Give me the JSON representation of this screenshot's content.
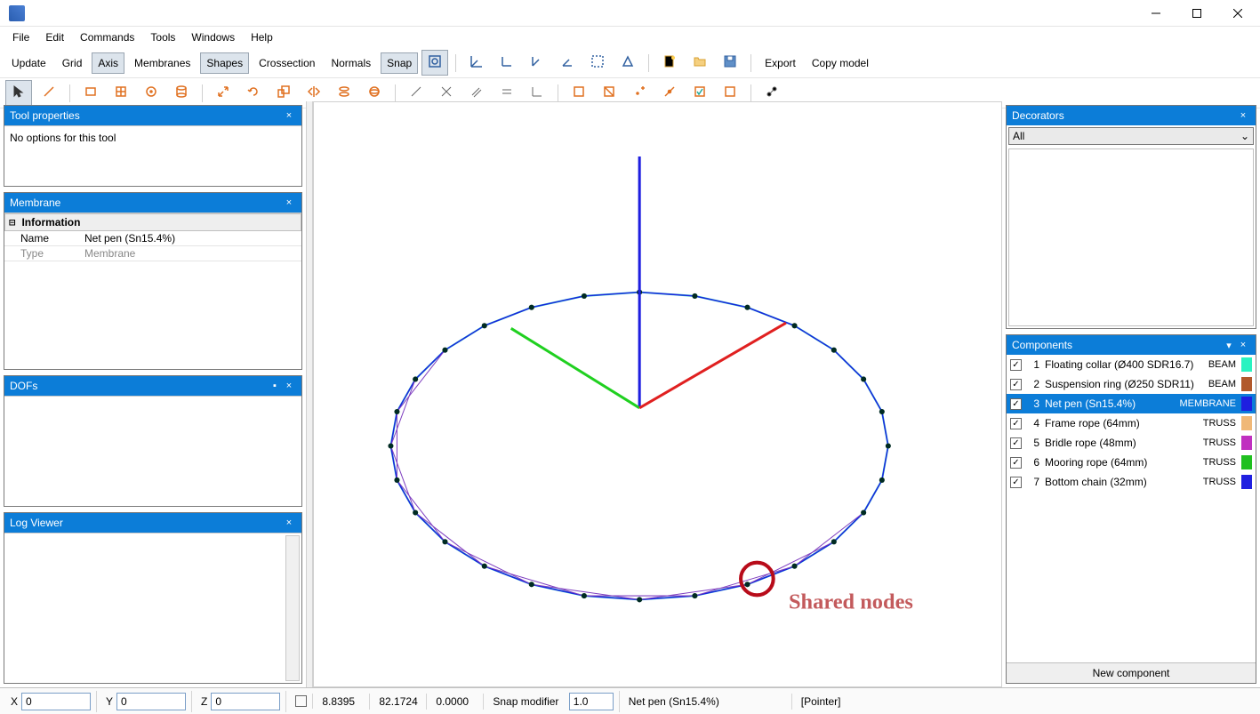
{
  "menu": {
    "file": "File",
    "edit": "Edit",
    "commands": "Commands",
    "tools": "Tools",
    "windows": "Windows",
    "help": "Help"
  },
  "toolbar1": {
    "update": "Update",
    "grid": "Grid",
    "axis": "Axis",
    "membranes": "Membranes",
    "shapes": "Shapes",
    "crossection": "Crossection",
    "normals": "Normals",
    "snap": "Snap",
    "export": "Export",
    "copymodel": "Copy model"
  },
  "panels": {
    "toolprops": {
      "title": "Tool properties",
      "body": "No options for this tool"
    },
    "membrane": {
      "title": "Membrane",
      "section": "Information",
      "name_k": "Name",
      "name_v": "Net pen (Sn15.4%)",
      "type_k": "Type",
      "type_v": "Membrane"
    },
    "dofs": {
      "title": "DOFs"
    },
    "log": {
      "title": "Log Viewer"
    },
    "decorators": {
      "title": "Decorators",
      "all": "All"
    },
    "components": {
      "title": "Components",
      "newcomp": "New component"
    }
  },
  "components": [
    {
      "idx": "1",
      "name": "Floating collar (Ø400 SDR16.7)",
      "type": "BEAM",
      "color": "#29f3c1"
    },
    {
      "idx": "2",
      "name": "Suspension ring (Ø250 SDR11)",
      "type": "BEAM",
      "color": "#b1592c"
    },
    {
      "idx": "3",
      "name": "Net pen (Sn15.4%)",
      "type": "MEMBRANE",
      "color": "#1e1ee0",
      "selected": true
    },
    {
      "idx": "4",
      "name": "Frame rope (64mm)",
      "type": "TRUSS",
      "color": "#f0b878"
    },
    {
      "idx": "5",
      "name": "Bridle rope (48mm)",
      "type": "TRUSS",
      "color": "#c030c0"
    },
    {
      "idx": "6",
      "name": "Mooring rope (64mm)",
      "type": "TRUSS",
      "color": "#20c020"
    },
    {
      "idx": "7",
      "name": "Bottom chain (32mm)",
      "type": "TRUSS",
      "color": "#2020e0"
    }
  ],
  "status": {
    "xlabel": "X",
    "x": "0",
    "ylabel": "Y",
    "y": "0",
    "zlabel": "Z",
    "z": "0",
    "c1": "8.8395",
    "c2": "82.1724",
    "c3": "0.0000",
    "snapmod": "Snap modifier",
    "snapv": "1.0",
    "sel": "Net pen (Sn15.4%)",
    "ptr": "[Pointer]"
  },
  "annotation": "Shared nodes"
}
